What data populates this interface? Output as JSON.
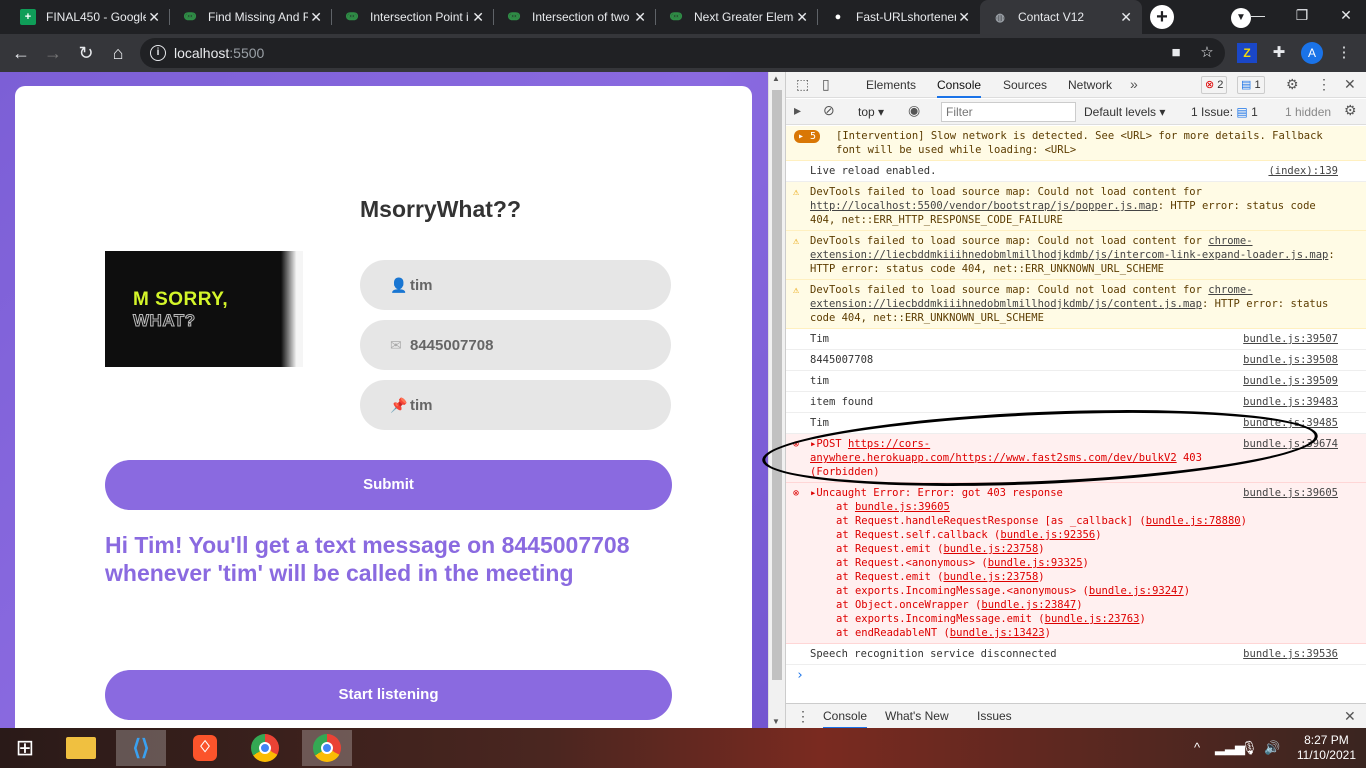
{
  "browser": {
    "tabs": [
      {
        "title": "FINAL450 - Google",
        "icon": "sheets-icon",
        "color": "#0f9d58"
      },
      {
        "title": "Find Missing And R",
        "icon": "gfg-icon",
        "color": "#2f8d46"
      },
      {
        "title": "Intersection Point i",
        "icon": "gfg-icon",
        "color": "#2f8d46"
      },
      {
        "title": "Intersection of two",
        "icon": "gfg-icon",
        "color": "#2f8d46"
      },
      {
        "title": "Next Greater Eleme",
        "icon": "gfg-icon",
        "color": "#2f8d46"
      },
      {
        "title": "Fast-URLshortener",
        "icon": "github-icon",
        "color": "#ffffff"
      },
      {
        "title": "Contact V12",
        "icon": "globe-icon",
        "color": "#9aa0a6"
      }
    ],
    "url_host": "localhost",
    "url_port": ":5500",
    "profile_initial": "A"
  },
  "page": {
    "heading": "MsorryWhat??",
    "logo_line1": "M SORRY,",
    "logo_line2": "WHAT?",
    "name_value": "tim",
    "phone_value": "8445007708",
    "keyword_value": "tim",
    "submit_label": "Submit",
    "message": "Hi Tim! You'll get a text message on 8445007708 whenever 'tim' will be called in the meeting",
    "start_label": "Start listening"
  },
  "devtools": {
    "tabs": [
      "Elements",
      "Console",
      "Sources",
      "Network"
    ],
    "error_count": "2",
    "message_count": "1",
    "context": "top",
    "filter_placeholder": "Filter",
    "levels": "Default levels",
    "issues": "1 Issue:",
    "issues_count": "1",
    "hidden": "1 hidden",
    "intervention_count": "5",
    "intervention_text": "[Intervention] Slow network is detected. See <URL> for more details. Fallback font will be used while loading: <URL>",
    "live_reload": "Live reload enabled.",
    "live_reload_src": "(index):139",
    "warn1_pre": "DevTools failed to load source map: Could not load content for ",
    "warn1_link": "http://localhost:5500/vendor/bootstrap/js/popper.js.map",
    "warn1_post": ": HTTP error: status code 404, net::ERR_HTTP_RESPONSE_CODE_FAILURE",
    "warn2_link": "chrome-extension://liecbddmkiiihnedobmlmillhodjkdmb/js/intercom-link-expand-loader.js.map",
    "warn2_post": ": HTTP error: status code 404, net::ERR_UNKNOWN_URL_SCHEME",
    "warn3_link": "chrome-extension://liecbddmkiiihnedobmlmillhodjkdmb/js/content.js.map",
    "warn3_post": ": HTTP error: status code 404, net::ERR_UNKNOWN_URL_SCHEME",
    "logs": [
      {
        "text": "Tim",
        "src": "bundle.js:39507"
      },
      {
        "text": "8445007708",
        "src": "bundle.js:39508"
      },
      {
        "text": "tim",
        "src": "bundle.js:39509"
      },
      {
        "text": "item found",
        "src": "bundle.js:39483"
      },
      {
        "text": "Tim",
        "src": "bundle.js:39485"
      }
    ],
    "post_method": "POST",
    "post_url": "https://cors-anywhere.herokuapp.com/https://www.fast2sms.com/dev/bulkV2",
    "post_status": "403 (Forbidden)",
    "post_src": "bundle.js:39674",
    "uncaught": "Uncaught Error: Error: got 403 response",
    "uncaught_src": "bundle.js:39605",
    "stack": [
      {
        "pre": "at ",
        "link": "bundle.js:39605",
        "post": ""
      },
      {
        "pre": "at Request.handleRequestResponse [as _callback] (",
        "link": "bundle.js:78880",
        "post": ")"
      },
      {
        "pre": "at Request.self.callback (",
        "link": "bundle.js:92356",
        "post": ")"
      },
      {
        "pre": "at Request.emit (",
        "link": "bundle.js:23758",
        "post": ")"
      },
      {
        "pre": "at Request.<anonymous> (",
        "link": "bundle.js:93325",
        "post": ")"
      },
      {
        "pre": "at Request.emit (",
        "link": "bundle.js:23758",
        "post": ")"
      },
      {
        "pre": "at exports.IncomingMessage.<anonymous> (",
        "link": "bundle.js:93247",
        "post": ")"
      },
      {
        "pre": "at Object.onceWrapper (",
        "link": "bundle.js:23847",
        "post": ")"
      },
      {
        "pre": "at exports.IncomingMessage.emit (",
        "link": "bundle.js:23763",
        "post": ")"
      },
      {
        "pre": "at endReadableNT (",
        "link": "bundle.js:13423",
        "post": ")"
      }
    ],
    "speech": "Speech recognition service disconnected",
    "speech_src": "bundle.js:39536",
    "drawer_tabs": [
      "Console",
      "What's New",
      "Issues"
    ]
  },
  "taskbar": {
    "time": "8:27 PM",
    "date": "11/10/2021"
  },
  "colors": {
    "accent": "#8a6ae0",
    "error": "#d00000",
    "warning": "#fffbe5"
  }
}
